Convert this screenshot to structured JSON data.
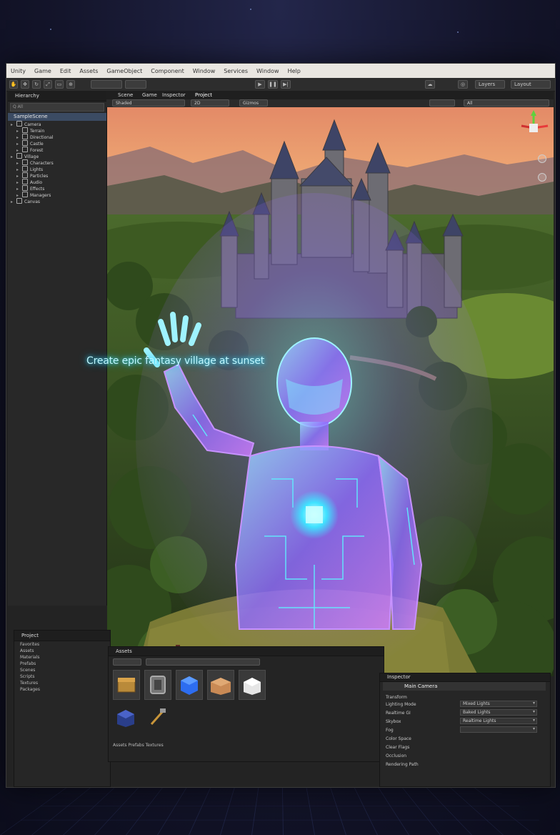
{
  "menu": [
    "Unity",
    "Game",
    "Edit",
    "Assets",
    "GameObject",
    "Component",
    "Window",
    "Services",
    "Window",
    "Help"
  ],
  "toolbar": {
    "account_label": "Account",
    "layers_label": "Layers",
    "layout_label": "Layout"
  },
  "hierarchy": {
    "tab": "Hierarchy",
    "search_placeholder": "Q All",
    "root": "SampleScene",
    "items": [
      "Camera",
      "Terrain",
      "Directional",
      "Castle",
      "Forest",
      "Village",
      "Characters",
      "Lights",
      "Particles",
      "Audio",
      "Effects",
      "Managers",
      "Canvas"
    ]
  },
  "scene": {
    "tabs": [
      "Scene",
      "Game",
      "Inspector",
      "Project"
    ],
    "shading": "Shaded",
    "mode_2d": "2D",
    "gizmos": "Gizmos",
    "search": "All",
    "prompt": "Create epic fantasy village at sunset"
  },
  "project": {
    "tab": "Project",
    "items": [
      "Favorites",
      "Assets",
      "Materials",
      "Prefabs",
      "Scenes",
      "Scripts",
      "Textures",
      "Packages"
    ]
  },
  "assets": {
    "header": "Assets",
    "footer": "Assets   Prefabs   Textures"
  },
  "inspector": {
    "tab": "Inspector",
    "object": "Main Camera",
    "section": "Transform",
    "rows": [
      "Lighting Mode",
      "Realtime GI",
      "Skybox",
      "Fog",
      "Color Space",
      "Clear Flags",
      "Occlusion",
      "Rendering Path"
    ],
    "dropdowns": [
      "Mixed Lights",
      "Baked Lights",
      "Realtime Lights",
      ""
    ]
  },
  "colors": {
    "accent_cyan": "#37e0ff",
    "hologram_violet": "#b36bff",
    "selection": "#3b4b63"
  }
}
